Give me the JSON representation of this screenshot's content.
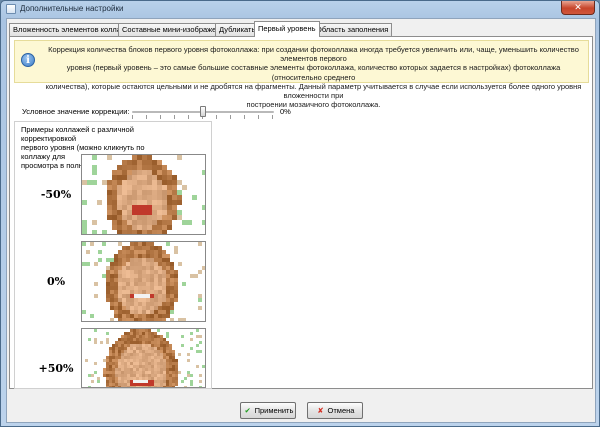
{
  "window": {
    "title": "Дополнительные настройки",
    "close_glyph": "✕"
  },
  "tabs": [
    {
      "label": "Вложенность элементов коллажа",
      "active": false
    },
    {
      "label": "Составные мини-изображения",
      "active": false
    },
    {
      "label": "Дубликаты",
      "active": false
    },
    {
      "label": "Первый уровень",
      "active": true
    },
    {
      "label": "Область заполнения",
      "active": false
    }
  ],
  "info": {
    "icon": "info-icon",
    "line1": "Коррекция количества блоков первого уровня фотоколлажа: при создании фотоколлажа иногда требуется увеличить или, чаще, уменьшить количество элементов первого",
    "line2": "уровня (первый уровень – это самые большие составные элементы фотоколлажа, количество которых задается в настройках) фотоколлажа (относительно среднего",
    "line3": "количества), которые остаются цельными и не дробятся на фрагменты. Данный параметр учитывается в случае если используется более одного уровня вложенности при",
    "line4": "построении мозаичного фотоколлажа."
  },
  "slider": {
    "label": "Условное значение коррекции:",
    "value_text": "0%",
    "value_fraction": 0.5
  },
  "examples": {
    "caption_line1": "Примеры коллажей с различной корректировкой",
    "caption_line2": "первого уровня (можно кликнуть по коллажу для",
    "caption_line3": "просмотра в полном разрешении).",
    "items": [
      {
        "label": "-50%"
      },
      {
        "label": "0%"
      },
      {
        "label": "+50%"
      }
    ]
  },
  "buttons": {
    "apply_label": "Применить",
    "apply_icon": "checkmark-icon",
    "cancel_label": "Отмена",
    "cancel_icon": "cross-icon"
  },
  "colors": {
    "info_background": "#fdf8d4",
    "apply_icon": "#1e9b1e",
    "cancel_icon": "#d42b1f"
  }
}
